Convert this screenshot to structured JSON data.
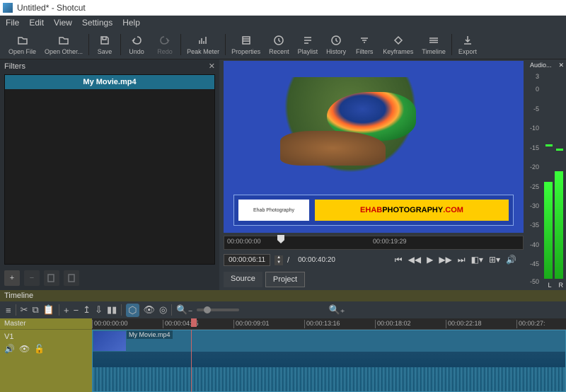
{
  "window": {
    "title": "Untitled* - Shotcut"
  },
  "menu": {
    "file": "File",
    "edit": "Edit",
    "view": "View",
    "settings": "Settings",
    "help": "Help"
  },
  "toolbar": {
    "open_file": "Open File",
    "open_other": "Open Other...",
    "save": "Save",
    "undo": "Undo",
    "redo": "Redo",
    "peak_meter": "Peak Meter",
    "properties": "Properties",
    "recent": "Recent",
    "playlist": "Playlist",
    "history": "History",
    "filters": "Filters",
    "keyframes": "Keyframes",
    "timeline": "Timeline",
    "export": "Export"
  },
  "filters": {
    "title": "Filters",
    "clip_name": "My Movie.mp4"
  },
  "preview": {
    "logo_text": "Ehab Photography",
    "url_p1": "EHAB",
    "url_p2": "PHOTOGRAPHY",
    "url_p3": ".COM",
    "ruler_start": "00:00:00:00",
    "ruler_end": "00:00:19:29",
    "current": "00:00:06:11",
    "total": "00:00:40:20",
    "sep": "/",
    "source_tab": "Source",
    "project_tab": "Project"
  },
  "audio": {
    "title": "Audio...",
    "scale": [
      "3",
      "0",
      "-5",
      "-10",
      "-15",
      "-20",
      "-25",
      "-30",
      "-35",
      "-40",
      "-45",
      "-50"
    ],
    "L": "L",
    "R": "R"
  },
  "timeline": {
    "title": "Timeline",
    "master": "Master",
    "track": "V1",
    "clip_label": "My Movie.mp4",
    "ruler": [
      "00:00:00:00",
      "00:00:04:15",
      "00:00:09:01",
      "00:00:13:16",
      "00:00:18:02",
      "00:00:22:18",
      "00:00:27:"
    ]
  }
}
